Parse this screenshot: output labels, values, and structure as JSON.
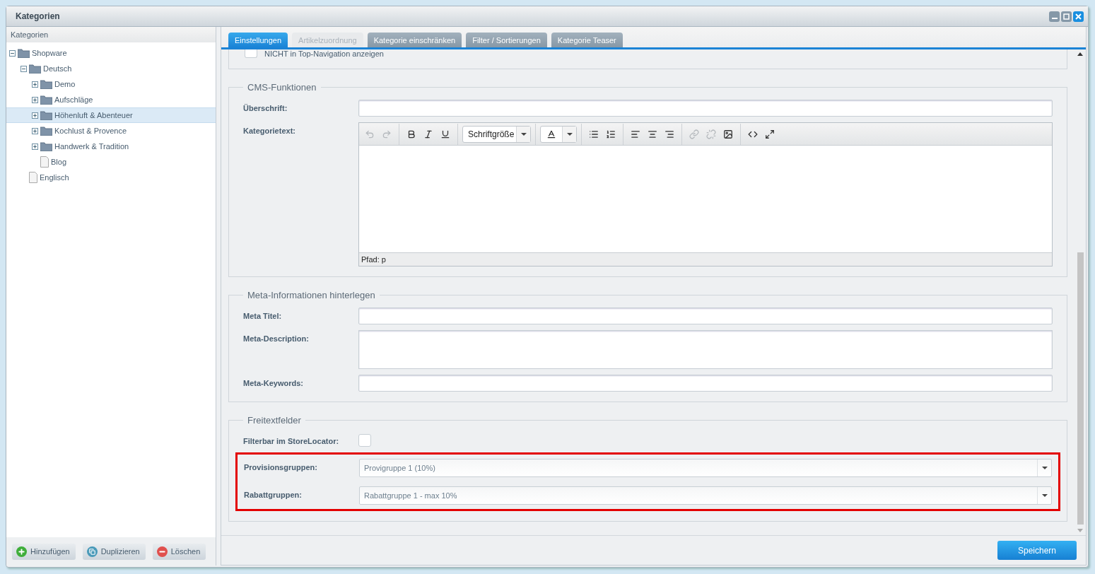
{
  "window": {
    "title": "Kategorien"
  },
  "sidebar": {
    "title": "Kategorien",
    "tree": [
      {
        "label": "Shopware",
        "kind": "folder",
        "expanded": true,
        "selected": false,
        "children": [
          {
            "label": "Deutsch",
            "kind": "folder",
            "expanded": true,
            "selected": false,
            "children": [
              {
                "label": "Demo",
                "kind": "folder",
                "expanded": false,
                "selected": false
              },
              {
                "label": "Aufschläge",
                "kind": "folder",
                "expanded": false,
                "selected": false
              },
              {
                "label": "Höhenluft & Abenteuer",
                "kind": "folder",
                "expanded": false,
                "selected": true
              },
              {
                "label": "Kochlust & Provence",
                "kind": "folder",
                "expanded": false,
                "selected": false
              },
              {
                "label": "Handwerk & Tradition",
                "kind": "folder",
                "expanded": false,
                "selected": false
              },
              {
                "label": "Blog",
                "kind": "page",
                "selected": false
              }
            ]
          },
          {
            "label": "Englisch",
            "kind": "page",
            "selected": false
          }
        ]
      }
    ],
    "buttons": [
      {
        "label": "Hinzufügen",
        "kind": "add"
      },
      {
        "label": "Duplizieren",
        "kind": "copy"
      },
      {
        "label": "Löschen",
        "kind": "delete"
      }
    ]
  },
  "tabs": [
    {
      "label": "Einstellungen",
      "selected": true,
      "disabled": false
    },
    {
      "label": "Artikelzuordnung",
      "selected": false,
      "disabled": true
    },
    {
      "label": "Kategorie einschränken",
      "selected": false,
      "disabled": false
    },
    {
      "label": "Filter / Sortierungen",
      "selected": false,
      "disabled": false
    },
    {
      "label": "Kategorie Teaser",
      "selected": false,
      "disabled": false
    }
  ],
  "top_option": {
    "label": "NICHT in Top-Navigation anzeigen",
    "checked": false
  },
  "cms": {
    "legend": "CMS-Funktionen",
    "heading_label": "Überschrift:",
    "text_label": "Kategorietext:",
    "font_size": "Schriftgröße",
    "path": "Pfad: p"
  },
  "meta": {
    "legend": "Meta-Informationen hinterlegen",
    "fields": [
      {
        "label": "Meta Titel:",
        "kind": "input"
      },
      {
        "label": "Meta-Description:",
        "kind": "textarea"
      },
      {
        "label": "Meta-Keywords:",
        "kind": "input"
      }
    ]
  },
  "freitext": {
    "legend": "Freitextfelder",
    "checkbox": {
      "label": "Filterbar im StoreLocator:",
      "checked": false
    },
    "highlighted": true,
    "selects": [
      {
        "label": "Provisionsgruppen:",
        "value": "Provigruppe 1 (10%)"
      },
      {
        "label": "Rabattgruppen:",
        "value": "Rabattgruppe 1 - max 10%"
      }
    ]
  },
  "save_button": "Speichern"
}
